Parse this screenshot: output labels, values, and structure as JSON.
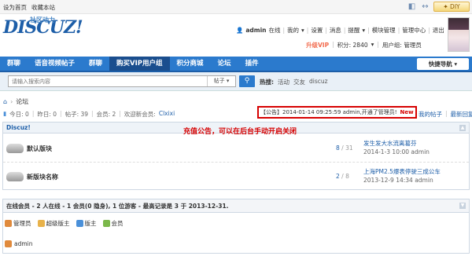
{
  "topbar": {
    "set_home": "设为首页",
    "bookmark": "收藏本站",
    "diy": "DIY"
  },
  "logo": {
    "brand": "DISCUZ!",
    "sub": "社区动力"
  },
  "user": {
    "name": "admin",
    "status": "在线",
    "menu": "我的",
    "settings": "设置",
    "messages": "消息",
    "remind": "提醒",
    "module": "模块管理",
    "admin_center": "管理中心",
    "logout": "退出",
    "vip": "升级VIP",
    "points": "积分: 2840",
    "group": "用户组: 管理员"
  },
  "nav": {
    "items": [
      "群聊",
      "语音视频帖子",
      "群聊",
      "购买VIP用户组",
      "积分商城",
      "论坛",
      "插件"
    ],
    "active": 3,
    "quick": "快捷导航"
  },
  "search": {
    "placeholder": "请输入搜索内容",
    "type": "帖子",
    "hot_label": "热搜:",
    "hot": [
      "活动",
      "交友",
      "discuz"
    ]
  },
  "breadcrumb": {
    "home": "⌂",
    "forum": "论坛"
  },
  "stats": {
    "today": "今日: 0",
    "yesterday": "昨日: 0",
    "posts": "帖子: 39",
    "members": "会员: 2",
    "welcome": "欢迎新会员:",
    "new_member": "Clxixi"
  },
  "notice": {
    "text": "【公告】2014-01-14 09:25:59 admin,开通了管理员!",
    "new": "New"
  },
  "links": {
    "my_posts": "我的帖子",
    "latest": "最新回复"
  },
  "category": {
    "title": "Discuz!"
  },
  "annotation": "充值公告，可以在后台手动开启关闭",
  "forums": [
    {
      "name": "默认版块",
      "threads": "8",
      "posts": "31",
      "last_title": "发生发大水流离葛芬",
      "last_meta": "2014-1-3 10:00 admin"
    },
    {
      "name": "新版块名称",
      "threads": "2",
      "posts": "8",
      "last_title": "上海PM2.5爆表停驶三成公车",
      "last_meta": "2013-12-9 14:34 admin"
    }
  ],
  "online": {
    "title": "在线会员 - 2 人在线 - 1 会员(0 隐身), 1 位游客 - 最高记录是 3 于 2013-12-31.",
    "legend": [
      {
        "label": "管理员",
        "color": "#e08a3c"
      },
      {
        "label": "超级版主",
        "color": "#e8b24a"
      },
      {
        "label": "版主",
        "color": "#4a90d9"
      },
      {
        "label": "会员",
        "color": "#7bb84a"
      }
    ],
    "users": [
      "admin"
    ]
  }
}
